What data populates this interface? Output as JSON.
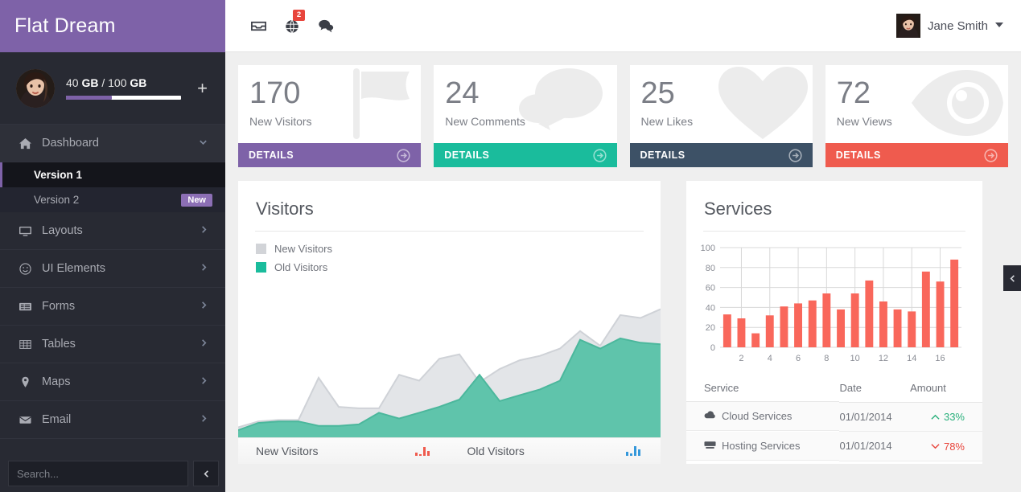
{
  "brand": {
    "title": "Flat Dream"
  },
  "sidebar": {
    "profile": {
      "storage_used": "40",
      "storage_unit1": "GB",
      "storage_sep": "/",
      "storage_total": "100",
      "storage_unit2": "GB",
      "storage_text": "40 GB / 100 GB",
      "progress_percent": 40,
      "add_label": "+"
    },
    "items": [
      {
        "label": "Dashboard",
        "icon": "home-icon",
        "caret": "chevron-down-icon",
        "expanded": true
      },
      {
        "label": "Layouts",
        "icon": "monitor-icon",
        "caret": "chevron-right-icon",
        "expanded": false
      },
      {
        "label": "UI Elements",
        "icon": "smiley-icon",
        "caret": "chevron-right-icon",
        "expanded": false
      },
      {
        "label": "Forms",
        "icon": "form-icon",
        "caret": "chevron-right-icon",
        "expanded": false
      },
      {
        "label": "Tables",
        "icon": "table-icon",
        "caret": "chevron-right-icon",
        "expanded": false
      },
      {
        "label": "Maps",
        "icon": "map-pin-icon",
        "caret": "chevron-right-icon",
        "expanded": false
      },
      {
        "label": "Email",
        "icon": "envelope-icon",
        "caret": "chevron-right-icon",
        "expanded": false
      }
    ],
    "subitems": [
      {
        "label": "Version 1",
        "active": true,
        "badge": ""
      },
      {
        "label": "Version 2",
        "active": false,
        "badge": "New"
      }
    ],
    "search": {
      "placeholder": "Search...",
      "value": ""
    },
    "collapse_icon": "chevron-left-icon"
  },
  "topbar": {
    "icons": [
      {
        "name": "inbox-icon",
        "badge": ""
      },
      {
        "name": "globe-notification-icon",
        "badge": "2"
      },
      {
        "name": "chat-icon",
        "badge": ""
      }
    ],
    "user": {
      "name": "Jane Smith",
      "caret": "caret-down-icon"
    }
  },
  "stats": [
    {
      "value": "170",
      "label": "New Visitors",
      "details": "DETAILS",
      "color": "#7e62a8",
      "icon": "flag-icon"
    },
    {
      "value": "24",
      "label": "New Comments",
      "details": "DETAILS",
      "color": "#1abc9c",
      "icon": "comments-icon"
    },
    {
      "value": "25",
      "label": "New Likes",
      "details": "DETAILS",
      "color": "#3d5166",
      "icon": "heart-icon"
    },
    {
      "value": "72",
      "label": "New Views",
      "details": "DETAILS",
      "color": "#ef5b4e",
      "icon": "eye-icon"
    }
  ],
  "visitors_panel": {
    "title": "Visitors",
    "legend": [
      {
        "label": "New Visitors",
        "color": "#d2d4d8"
      },
      {
        "label": "Old Visitors",
        "color": "#1abc9c"
      }
    ],
    "footer": [
      {
        "label": "New Visitors",
        "spark": "sparkline-red-icon"
      },
      {
        "label": "Old Visitors",
        "spark": "sparkline-blue-icon"
      }
    ]
  },
  "services_panel": {
    "title": "Services",
    "table": {
      "columns": [
        "Service",
        "Date",
        "Amount"
      ],
      "rows": [
        {
          "service": "Cloud Services",
          "icon": "cloud-icon",
          "date": "01/01/2014",
          "amount": "33%",
          "trend": "up"
        },
        {
          "service": "Hosting Services",
          "icon": "server-icon",
          "date": "01/01/2014",
          "amount": "78%",
          "trend": "down"
        }
      ]
    }
  },
  "edge_toggle": {
    "icon": "chevron-left-icon"
  },
  "chart_data": [
    {
      "type": "area",
      "title": "Visitors",
      "xlabel": "",
      "ylabel": "",
      "grid": false,
      "legend_position": "top-left",
      "x": [
        1,
        2,
        3,
        4,
        5,
        6,
        7,
        8,
        9,
        10,
        11,
        12,
        13,
        14,
        15,
        16,
        17,
        18,
        19,
        20,
        21,
        22
      ],
      "series": [
        {
          "name": "New Visitors",
          "color": "#e3e5e8",
          "values": [
            8,
            12,
            13,
            13,
            42,
            22,
            21,
            21,
            44,
            40,
            55,
            58,
            39,
            48,
            54,
            57,
            62,
            74,
            64,
            85,
            83,
            89
          ]
        },
        {
          "name": "Old Visitors",
          "color": "#5fc4ab",
          "values": [
            6,
            11,
            12,
            12,
            9,
            9,
            10,
            18,
            14,
            18,
            22,
            27,
            44,
            26,
            30,
            34,
            40,
            68,
            62,
            69,
            66,
            65
          ]
        }
      ],
      "ylim": [
        0,
        100
      ]
    },
    {
      "type": "bar",
      "title": "Services",
      "xlabel": "",
      "ylabel": "",
      "grid": true,
      "color": "#f9675b",
      "categories": [
        1,
        2,
        3,
        4,
        5,
        6,
        7,
        8,
        9,
        10,
        11,
        12,
        13,
        14,
        15,
        16,
        17
      ],
      "tick_labels": [
        2,
        4,
        6,
        8,
        10,
        12,
        14,
        16
      ],
      "values": [
        33,
        29,
        14,
        32,
        41,
        44,
        47,
        54,
        38,
        54,
        67,
        46,
        38,
        36,
        76,
        66,
        88
      ],
      "yticks": [
        0,
        20,
        40,
        60,
        80,
        100
      ],
      "ylim": [
        0,
        100
      ]
    }
  ]
}
